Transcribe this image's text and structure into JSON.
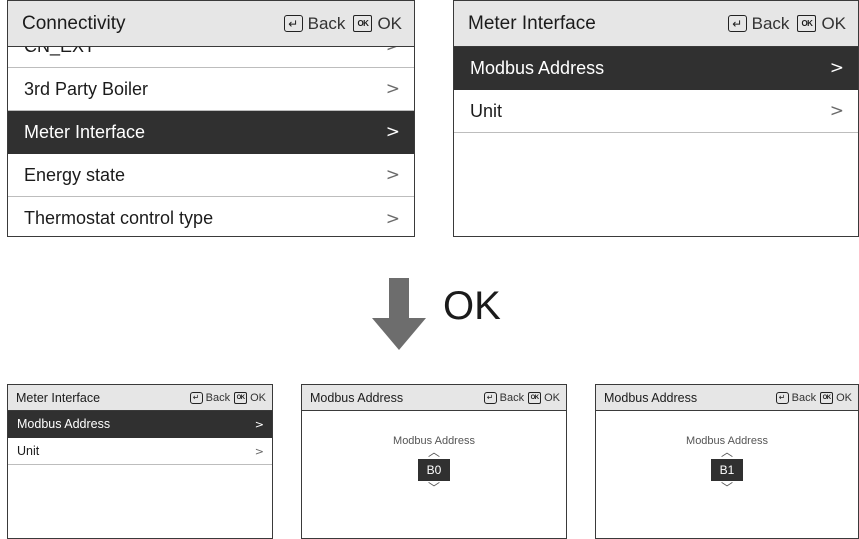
{
  "screens": {
    "connectivity": {
      "title": "Connectivity",
      "back_label": "Back",
      "ok_label": "OK",
      "items": [
        {
          "label": "CN_EXT",
          "chevron": ">"
        },
        {
          "label": "3rd Party Boiler",
          "chevron": ">"
        },
        {
          "label": "Meter Interface",
          "chevron": ">",
          "selected": true
        },
        {
          "label": "Energy state",
          "chevron": ">"
        },
        {
          "label": "Thermostat control type",
          "chevron": ">"
        }
      ]
    },
    "meter_interface_large": {
      "title": "Meter Interface",
      "back_label": "Back",
      "ok_label": "OK",
      "items": [
        {
          "label": "Modbus Address",
          "chevron": ">",
          "selected": true
        },
        {
          "label": "Unit",
          "chevron": ">"
        }
      ]
    },
    "meter_interface_small": {
      "title": "Meter Interface",
      "back_label": "Back",
      "ok_label": "OK",
      "items": [
        {
          "label": "Modbus Address",
          "chevron": ">",
          "selected": true
        },
        {
          "label": "Unit",
          "chevron": ">"
        }
      ]
    },
    "modbus_b0": {
      "title": "Modbus Address",
      "back_label": "Back",
      "ok_label": "OK",
      "picker_label": "Modbus Address",
      "value": "B0"
    },
    "modbus_b1": {
      "title": "Modbus Address",
      "back_label": "Back",
      "ok_label": "OK",
      "picker_label": "Modbus Address",
      "value": "B1"
    }
  },
  "transition": {
    "label": "OK",
    "arrow_icon": "down-arrow-icon",
    "arrow_color": "#6d6d6d"
  },
  "icons": {
    "back": "back-return-icon",
    "ok": "ok-key-icon",
    "ok_key_text": "OK",
    "back_glyph": "⮌",
    "up": "chevron-up-icon",
    "down": "chevron-down-icon",
    "up_glyph": "︿",
    "down_glyph": "﹀"
  },
  "colors": {
    "header_bg": "#e6e6e6",
    "selected_bg": "#303030",
    "border": "#3a3a3a"
  }
}
